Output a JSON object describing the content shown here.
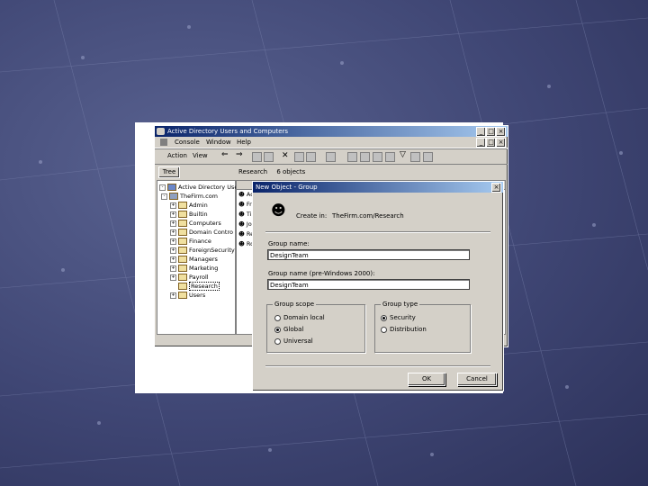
{
  "app_window": {
    "title": "Active Directory Users and Computers",
    "menu": [
      "Console",
      "Window",
      "Help"
    ],
    "toolbar_menu": [
      "Action",
      "View"
    ],
    "tree_header": "Tree",
    "tree": {
      "root": "Active Directory Users",
      "domain": "TheFirm.com",
      "items": [
        "Admin",
        "Builtin",
        "Computers",
        "Domain Contro",
        "Finance",
        "ForeignSecurity",
        "Managers",
        "Marketing",
        "Payroll",
        "Research",
        "Users"
      ],
      "selected": "Research"
    },
    "details_header": {
      "container": "Research",
      "count": "6 objects"
    },
    "list_items": [
      "Ad",
      "Fr",
      "Ti",
      "Jo",
      "Re",
      "Ro"
    ]
  },
  "dialog": {
    "title": "New Object - Group",
    "create_in_label": "Create in:",
    "create_in_value": "TheFirm.com/Research",
    "group_name_label": "Group name:",
    "group_name_value": "DesignTeam",
    "group_name_pre2000_label": "Group name (pre-Windows 2000):",
    "group_name_pre2000_value": "DesignTeam",
    "group_scope": {
      "title": "Group scope",
      "options": [
        "Domain local",
        "Global",
        "Universal"
      ],
      "selected": "Global"
    },
    "group_type": {
      "title": "Group type",
      "options": [
        "Security",
        "Distribution"
      ],
      "selected": "Security"
    },
    "ok_label": "OK",
    "cancel_label": "Cancel"
  }
}
